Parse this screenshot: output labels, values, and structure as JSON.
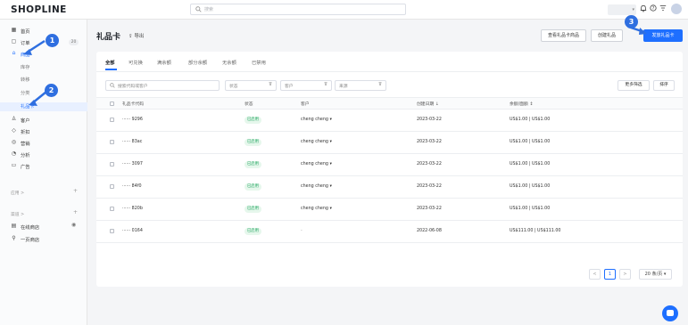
{
  "header": {
    "logo": "SHOPLINE",
    "search_placeholder": "搜索",
    "icons": [
      "bell-icon",
      "help-icon",
      "filter-icon",
      "avatar"
    ]
  },
  "sidebar": {
    "items": [
      {
        "icon": "home-icon",
        "label": "首页"
      },
      {
        "icon": "order-icon",
        "label": "订单",
        "badge": "20"
      },
      {
        "icon": "product-icon",
        "label": "商品"
      },
      {
        "icon": "customer-icon",
        "label": "客户"
      },
      {
        "icon": "discount-icon",
        "label": "折扣"
      },
      {
        "icon": "marketing-icon",
        "label": "营销"
      },
      {
        "icon": "analytics-icon",
        "label": "分析"
      },
      {
        "icon": "ads-icon",
        "label": "广告"
      }
    ],
    "product_sub": [
      "库存",
      "转移",
      "分类",
      "礼品卡"
    ],
    "section_apps": "应用 >",
    "section_channels": "渠道 >",
    "channels": [
      {
        "icon": "store-icon",
        "label": "在线商店"
      },
      {
        "icon": "pos-icon",
        "label": "一页商店"
      }
    ]
  },
  "page": {
    "title": "礼品卡",
    "export": "导出",
    "buttons": {
      "view_products": "查看礼品卡商品",
      "create_product": "创建礼品",
      "issue": "发放礼品卡"
    }
  },
  "tabs": [
    "全部",
    "可兑换",
    "满余额",
    "部分余额",
    "无余额",
    "已禁用"
  ],
  "filters": {
    "search_placeholder": "搜索代码或客户",
    "status": "状态",
    "customer": "客户",
    "source": "来源",
    "more": "更多筛选",
    "sort": "排序"
  },
  "table": {
    "headers": [
      "礼品卡代码",
      "状态",
      "客户",
      "创建日期 ↓",
      "余额/面额 ↕"
    ],
    "rows": [
      {
        "code": "······ 9296",
        "status": "已启用",
        "customer": "cheng cheng ▾",
        "date": "2023-03-22",
        "balance": "US$1.00 | US$1.00"
      },
      {
        "code": "······ 83ac",
        "status": "已启用",
        "customer": "cheng cheng ▾",
        "date": "2023-03-22",
        "balance": "US$1.00 | US$1.00"
      },
      {
        "code": "······ 3097",
        "status": "已启用",
        "customer": "cheng cheng ▾",
        "date": "2023-03-22",
        "balance": "US$1.00 | US$1.00"
      },
      {
        "code": "······ 84f0",
        "status": "已启用",
        "customer": "cheng cheng ▾",
        "date": "2023-03-22",
        "balance": "US$1.00 | US$1.00"
      },
      {
        "code": "······ 820b",
        "status": "已启用",
        "customer": "cheng cheng ▾",
        "date": "2023-03-22",
        "balance": "US$1.00 | US$1.00"
      },
      {
        "code": "······ 0164",
        "status": "已启用",
        "customer": "-",
        "date": "2022-06-08",
        "balance": "US$111.00 | US$111.00"
      }
    ]
  },
  "pagination": {
    "prev": "<",
    "current": "1",
    "next": ">",
    "page_size": "20 条/页 ▾"
  },
  "callouts": [
    "1",
    "2",
    "3"
  ],
  "colors": {
    "primary": "#1e6fff",
    "callout": "#2f6fe0",
    "status_bg": "#e6f7ec",
    "status_text": "#19a35a"
  }
}
